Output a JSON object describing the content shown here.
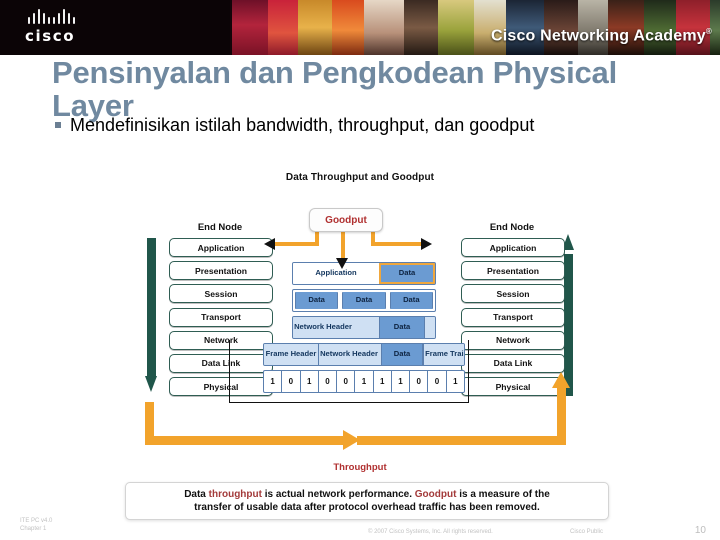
{
  "banner": {
    "brand_word": "cisco",
    "brand_mark": "cisco-logo",
    "academy_text": "Cisco Networking Academy",
    "academy_trademark": "®"
  },
  "slide": {
    "title": "Pensinyalan dan Pengkodean Physical Layer",
    "bullets": [
      "Mendefinisikan istilah bandwidth, throughput, dan goodput"
    ]
  },
  "diagram": {
    "title": "Data Throughput and Goodput",
    "end_node_left": "End Node",
    "end_node_right": "End Node",
    "goodput_label": "Goodput",
    "throughput_label": "Throughput",
    "layers": [
      "Application",
      "Presentation",
      "Session",
      "Transport",
      "Network",
      "Data Link",
      "Physical"
    ],
    "encapsulation": {
      "row_application": [
        "Application",
        "Data"
      ],
      "row_segments": [
        "Data",
        "Data",
        "Data"
      ],
      "row_packet": [
        "Network Header",
        "Data"
      ],
      "row_frame": [
        "Frame Header",
        "Network Header",
        "Data",
        "Frame Trailer"
      ],
      "bits": [
        "1",
        "0",
        "1",
        "0",
        "0",
        "1",
        "1",
        "1",
        "0",
        "0",
        "1"
      ]
    },
    "colors": {
      "arrow_green": "#20564a",
      "arrow_orange": "#f2a32b",
      "data_blue": "#6b9bd2",
      "panel_blue": "#cfe0f3",
      "accent_red": "#b03030"
    }
  },
  "caption": {
    "line1_a": "Data ",
    "line1_b": "throughput",
    "line1_c": " is actual network performance. ",
    "line1_d": "Goodput",
    "line1_e": " is a measure of the",
    "line2": "transfer of usable data after protocol overhead traffic has been removed."
  },
  "footer": {
    "course": "ITE PC v4.0",
    "chapter": "Chapter 1",
    "copyright": "© 2007 Cisco Systems, Inc. All rights reserved.",
    "classification": "Cisco Public",
    "page_number": "10"
  }
}
